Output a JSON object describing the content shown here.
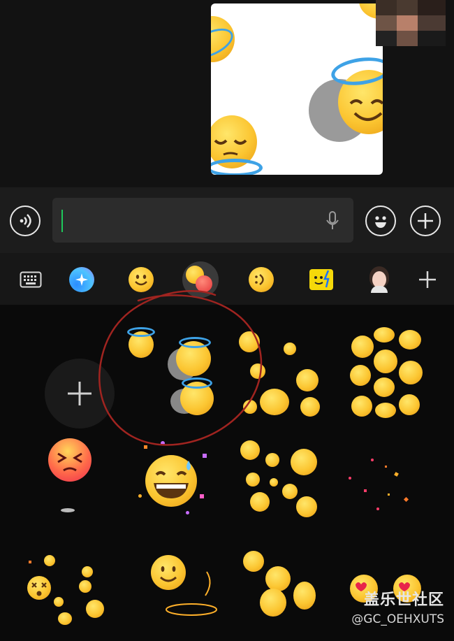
{
  "chat": {
    "sent_sticker": "halo-smiling-face-sticker"
  },
  "input_bar": {
    "voice_button_icon": "voice-wave-icon",
    "text_value": "",
    "mic_icon": "microphone-icon",
    "emoji_button_icon": "smiley-icon",
    "more_button_icon": "plus-icon"
  },
  "emoji_tabs": [
    {
      "name": "keyboard",
      "icon": "keyboard-icon"
    },
    {
      "name": "ai-sparkle",
      "icon": "sparkle-icon"
    },
    {
      "name": "emoji",
      "icon": "smiley-icon"
    },
    {
      "name": "sticker-combo",
      "icon": "emoji-mix-icon",
      "selected": true
    },
    {
      "name": "emoticon",
      "icon": "emoticon-icon"
    },
    {
      "name": "custom-sticker",
      "icon": "yellow-sticker-icon"
    },
    {
      "name": "avatar",
      "icon": "avatar-icon"
    },
    {
      "name": "add",
      "icon": "plus-icon"
    }
  ],
  "sticker_grid": [
    {
      "name": "add-sticker"
    },
    {
      "name": "halo-faces",
      "annotated": true
    },
    {
      "name": "tears-of-joy-faces"
    },
    {
      "name": "winking-melting-faces"
    },
    {
      "name": "persevering-face"
    },
    {
      "name": "grinning-sweat-confetti"
    },
    {
      "name": "heart-eyes-faces"
    },
    {
      "name": "confetti-burst"
    },
    {
      "name": "dizzy-faces"
    },
    {
      "name": "smiling-face-spotlight"
    },
    {
      "name": "upside-down-faces"
    },
    {
      "name": "heart-eyes-pair"
    }
  ],
  "watermark": {
    "title": "盖乐世社区",
    "handle": "@GC_OEHXUTS"
  },
  "colors": {
    "caret": "#1ec95b",
    "annotation_circle": "#a02420",
    "halo": "#3ea2e6"
  }
}
